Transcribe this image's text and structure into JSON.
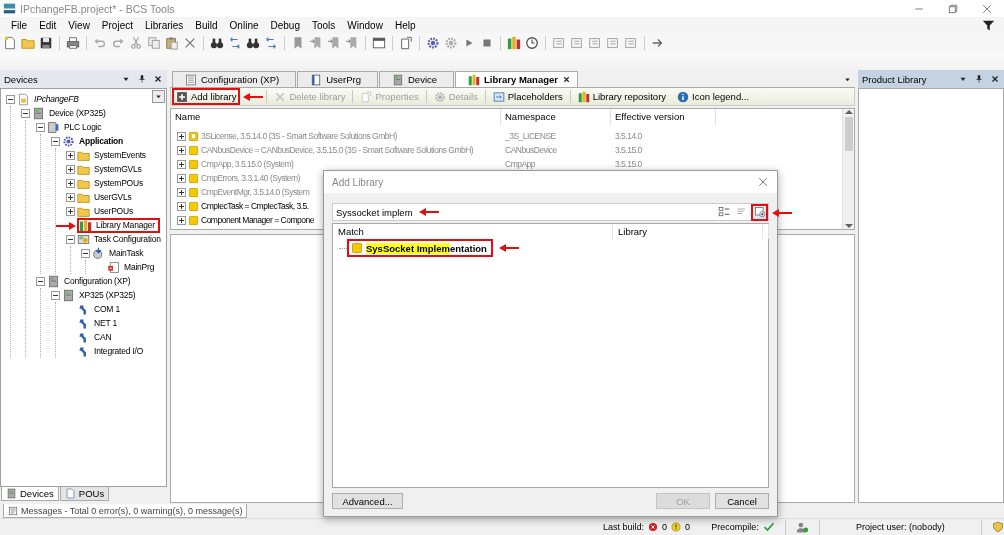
{
  "window": {
    "title": "IPchangeFB.project* - BCS Tools"
  },
  "menu": [
    "File",
    "Edit",
    "View",
    "Project",
    "Libraries",
    "Build",
    "Online",
    "Debug",
    "Tools",
    "Window",
    "Help"
  ],
  "devices_panel": {
    "title": "Devices",
    "tree": [
      {
        "label": "IPchangeFB",
        "kind": "project",
        "expanded": true,
        "children": [
          {
            "label": "Device (XP325)",
            "kind": "device",
            "expanded": true,
            "children": [
              {
                "label": "PLC Logic",
                "kind": "plc",
                "expanded": true,
                "children": [
                  {
                    "label": "Application",
                    "kind": "application",
                    "expanded": true,
                    "active": true,
                    "children": [
                      {
                        "label": "SystemEvents",
                        "kind": "folder",
                        "expanded": false
                      },
                      {
                        "label": "SystemGVLs",
                        "kind": "folder",
                        "expanded": false
                      },
                      {
                        "label": "SystemPOUs",
                        "kind": "folder",
                        "expanded": false
                      },
                      {
                        "label": "UserGVLs",
                        "kind": "folder",
                        "expanded": false
                      },
                      {
                        "label": "UserPOUs",
                        "kind": "folder",
                        "expanded": false
                      },
                      {
                        "label": "Library Manager",
                        "kind": "library",
                        "marked": true
                      },
                      {
                        "label": "Task Configuration",
                        "kind": "task-config",
                        "expanded": true,
                        "children": [
                          {
                            "label": "MainTask",
                            "kind": "task",
                            "expanded": true,
                            "children": [
                              {
                                "label": "MainPrg",
                                "kind": "program"
                              }
                            ]
                          }
                        ]
                      }
                    ]
                  }
                ]
              },
              {
                "label": "Configuration (XP)",
                "kind": "device",
                "expanded": true,
                "children": [
                  {
                    "label": "XP325 (XP325)",
                    "kind": "device",
                    "expanded": true,
                    "children": [
                      {
                        "label": "COM 1",
                        "kind": "port"
                      },
                      {
                        "label": "NET 1",
                        "kind": "port"
                      },
                      {
                        "label": "CAN",
                        "kind": "port"
                      },
                      {
                        "label": "Integrated I/O",
                        "kind": "port"
                      }
                    ]
                  }
                ]
              }
            ]
          }
        ]
      }
    ],
    "panel_tabs": [
      {
        "label": "Devices",
        "selected": true
      },
      {
        "label": "POUs",
        "selected": false
      }
    ]
  },
  "editor": {
    "tabs": [
      {
        "label": "Configuration (XP)",
        "selected": false
      },
      {
        "label": "UserPrg",
        "selected": false
      },
      {
        "label": "Device",
        "selected": false
      },
      {
        "label": "Library Manager",
        "selected": true
      }
    ],
    "library_toolbar": [
      {
        "label": "Add library",
        "disabled": false,
        "marked": true
      },
      {
        "label": "Delete library",
        "disabled": true,
        "marked": false
      },
      {
        "label": "Properties",
        "disabled": true,
        "marked": false
      },
      {
        "label": "Details",
        "disabled": true,
        "marked": false
      },
      {
        "label": "Placeholders",
        "disabled": false,
        "marked": false
      },
      {
        "label": "Library repository",
        "disabled": false,
        "marked": false
      },
      {
        "label": "Icon legend...",
        "disabled": false,
        "marked": false
      }
    ],
    "library_table": {
      "columns": [
        "Name",
        "Namespace",
        "Effective version"
      ],
      "rows": [
        {
          "name": "3SLicense, 3.5.14.0 (3S - Smart Software Solutions GmbH)",
          "namespace": "_3S_LICENSE",
          "version": "3.5.14.0",
          "kind": "license",
          "dimmed": true,
          "expanded": false
        },
        {
          "name": "CANbusDevice = CANbusDevice, 3.5.15.0 (3S - Smart Software Solutions GmbH)",
          "namespace": "CANbusDevice",
          "version": "3.5.15.0",
          "kind": "library",
          "dimmed": true,
          "expanded": false
        },
        {
          "name": "CmpApp, 3.5.15.0 (System)",
          "namespace": "CmpApp",
          "version": "3.5.15.0",
          "kind": "library",
          "dimmed": true,
          "expanded": false
        },
        {
          "name": "CmpErrors, 3.3.1.40 (System)",
          "kind": "library",
          "dimmed": true,
          "expanded": false
        },
        {
          "name": "CmpEventMgr, 3.5.14.0 (System",
          "kind": "library",
          "dimmed": true,
          "expanded": false
        },
        {
          "name": "CmpIecTask = CmpIecTask, 3.5.",
          "kind": "library",
          "dimmed": false,
          "expanded": false
        },
        {
          "name": "Component Manager = Compone",
          "kind": "library",
          "dimmed": false,
          "expanded": false
        }
      ]
    }
  },
  "product_library": {
    "title": "Product Library"
  },
  "messages_tab": {
    "label": "Messages - Total 0 error(s), 0 warning(s), 0 message(s)"
  },
  "status_bar": {
    "last_build": "Last build:",
    "errors": "0",
    "warnings": "0",
    "precompile": "Precompile:",
    "precompile_ok": true,
    "project_user": "Project user: (nobody)"
  },
  "dialog": {
    "title": "Add Library",
    "search": {
      "value": "Syssocket implem",
      "marked": true
    },
    "search_buttons": [
      {
        "marked": false
      },
      {
        "marked": false
      },
      {
        "marked": true
      }
    ],
    "columns": [
      "Match",
      "Library"
    ],
    "results": [
      {
        "parts": [
          {
            "text": "SysSocket Implem",
            "matched": true
          },
          {
            "text": "entation",
            "matched": false
          }
        ],
        "marked": true
      }
    ],
    "buttons": [
      {
        "label": "Advanced...",
        "disabled": false
      },
      {
        "label": "OK",
        "disabled": true
      },
      {
        "label": "Cancel",
        "disabled": false
      }
    ]
  }
}
